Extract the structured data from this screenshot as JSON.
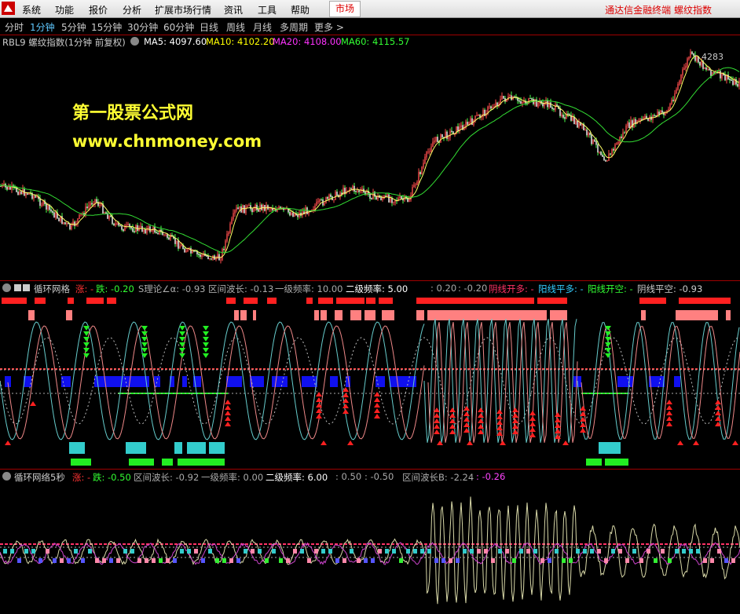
{
  "menu": {
    "items": [
      "系统",
      "功能",
      "报价",
      "分析",
      "扩展市场行情",
      "资讯",
      "工具",
      "帮助"
    ],
    "market_button": "市场",
    "brand": "通达信金融终端  螺纹指数"
  },
  "periods": {
    "items": [
      "分时",
      "1分钟",
      "5分钟",
      "15分钟",
      "30分钟",
      "60分钟",
      "日线",
      "周线",
      "月线",
      "多周期",
      "更多 >"
    ],
    "active_index": 1
  },
  "main": {
    "symbol_title": "RBL9 螺纹指数(1分钟 前复权)",
    "ma5": "MA5: 4097.60",
    "ma10": "MA10: 4102.20",
    "ma20": "MA20: 4108.00",
    "ma60": "MA60: 4115.57",
    "high_label": "4283",
    "watermark_cn": "第一股票公式网",
    "watermark_url": "www.chnmoney.com",
    "colors": {
      "ma5": "#ffffff",
      "ma10": "#ffff00",
      "ma20": "#ff33ff",
      "ma60": "#33ff33"
    }
  },
  "panel1": {
    "title": "循环网格",
    "up": "涨: -",
    "down": "跌: -0.20",
    "theory_angle": "S理论∠α: -0.93",
    "range_wave": "区间波长: -0.13",
    "freq1": "一级频率: 10.00",
    "freq2": "二级频率: 5.00",
    "v1": ": 0.20",
    "v2": ": -0.20",
    "yin_open_long": "阴线开多: -",
    "yang_flat_long": "阳线平多: -",
    "yang_open_short": "阳线开空: -",
    "yin_flat_short": "阴线平空: -0.93"
  },
  "panel2": {
    "title": "循环网络5秒",
    "up": "涨: -",
    "down": "跌: -0.50",
    "range_wave": "区间波长: -0.92",
    "freq1": "一级频率: 0.00",
    "freq2": "二级频率: 6.00",
    "v1": ": 0.50",
    "v2": ": -0.50",
    "range_wave_b": "区间波长B: -2.24",
    "v3": ": -0.26"
  }
}
